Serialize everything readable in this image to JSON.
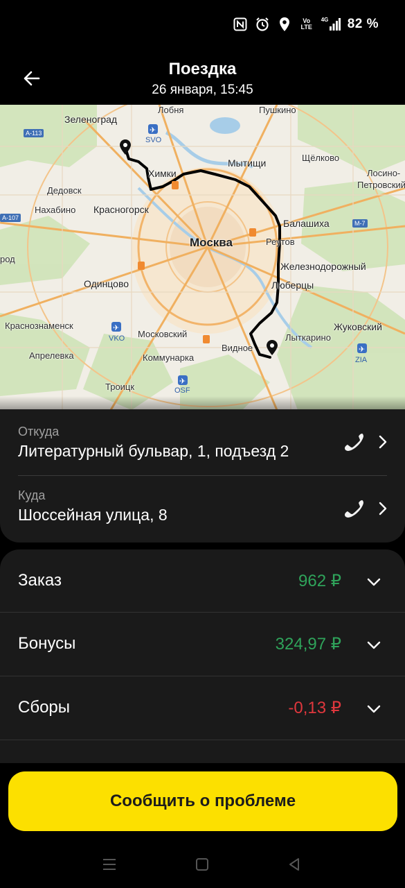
{
  "status_bar": {
    "nfc_icon": "nfc-icon",
    "alarm_icon": "alarm-icon",
    "location_icon": "location-icon",
    "volte_top": "Vo",
    "volte_bottom": "LTE",
    "network": "4G",
    "battery": "82 %"
  },
  "header": {
    "title": "Поездка",
    "subtitle": "26 января, 15:45",
    "back_icon": "arrow-left-icon"
  },
  "map": {
    "labels": {
      "zelenograd": "Зеленоград",
      "lobnya": "Лобня",
      "pushkino": "Пушкино",
      "svo": "SVO",
      "khimki": "Химки",
      "mytishchi": "Мытищи",
      "shchelkovo": "Щёлково",
      "losino": "Лосино-",
      "petrovsky": "Петровский",
      "dedovsk": "Дедовск",
      "nakhabino": "Нахабино",
      "krasnogorsk": "Красногорск",
      "balashikha": "Балашиха",
      "moskva": "Москва",
      "reutov": "Реутов",
      "zheleznodorozhny": "Железнодорожный",
      "rod": "род",
      "odintsovo": "Одинцово",
      "lyubertsy": "Люберцы",
      "krasnoznamensk": "Краснознаменск",
      "vko": "VKO",
      "moskovsky": "Московский",
      "lytkarino": "Лыткарино",
      "zhukovsky": "Жуковский",
      "vidnoe": "Видное",
      "zia": "ZIA",
      "aprelevka": "Апрелевка",
      "kommunarka": "Коммунарка",
      "osf": "OSF",
      "troitsk": "Троицк",
      "road_a113": "А-113",
      "road_a107": "А-107",
      "road_m7": "М-7"
    }
  },
  "route": {
    "from_label": "Откуда",
    "from_value": "Литературный бульвар, 1, подъезд 2",
    "to_label": "Куда",
    "to_value": "Шоссейная улица, 8"
  },
  "costs": [
    {
      "label": "Заказ",
      "value": "962 ₽",
      "color": "#2fa35a"
    },
    {
      "label": "Бонусы",
      "value": "324,97 ₽",
      "color": "#2fa35a"
    },
    {
      "label": "Сборы",
      "value": "-0,13 ₽",
      "color": "#e0373d"
    }
  ],
  "report_button": "Сообщить о проблеме",
  "colors": {
    "accent_yellow": "#fce000",
    "positive": "#2fa35a",
    "negative": "#e0373d",
    "card_bg": "#1a1a1a"
  }
}
